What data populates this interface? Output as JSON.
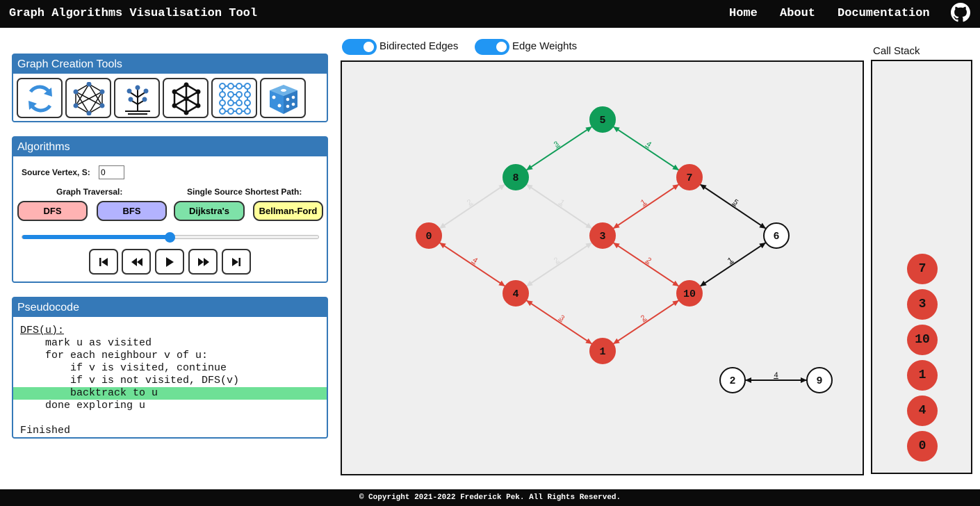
{
  "header": {
    "title": "Graph Algorithms Visualisation Tool",
    "nav": [
      "Home",
      "About",
      "Documentation"
    ],
    "github_icon": "github-icon"
  },
  "toggles": [
    {
      "label": "Bidirected Edges",
      "on": true
    },
    {
      "label": "Edge Weights",
      "on": true
    }
  ],
  "creation_tools": {
    "title": "Graph Creation Tools",
    "tools": [
      {
        "name": "reset-graph",
        "icon": "refresh-icon"
      },
      {
        "name": "complete-graph",
        "icon": "complete-graph-icon"
      },
      {
        "name": "tree-graph",
        "icon": "tree-icon"
      },
      {
        "name": "wheel-graph",
        "icon": "wheel-graph-icon"
      },
      {
        "name": "grid-graph",
        "icon": "grid-graph-icon"
      },
      {
        "name": "random-graph",
        "icon": "dice-icon"
      }
    ]
  },
  "algorithms": {
    "title": "Algorithms",
    "source_label": "Source Vertex, S:",
    "source_value": "0",
    "traversal_label": "Graph Traversal:",
    "sssp_label": "Single Source Shortest Path:",
    "buttons": [
      {
        "label": "DFS",
        "color": "#ffb3b3"
      },
      {
        "label": "BFS",
        "color": "#b3b3ff"
      },
      {
        "label": "Dijkstra's",
        "color": "#7ee2a8"
      },
      {
        "label": "Bellman-Ford",
        "color": "#ffff99"
      }
    ],
    "slider_value": 0.5,
    "controls": [
      "skip-to-start-icon",
      "rewind-icon",
      "play-icon",
      "fast-forward-icon",
      "skip-to-end-icon"
    ]
  },
  "pseudocode": {
    "title": "Pseudocode",
    "lines": [
      "DFS(u):",
      "    mark u as visited",
      "    for each neighbour v of u:",
      "        if v is visited, continue",
      "        if v is not visited, DFS(v)",
      "        backtrack to u",
      "    done exploring u",
      "",
      "Finished"
    ],
    "highlighted": 5
  },
  "graph": {
    "colors": {
      "visited": "#dc4337",
      "done": "#109d58",
      "unvisited": "#ffffff",
      "inactive_edge": "#d9d9d9",
      "plain_edge": "#111111"
    },
    "nodes": [
      {
        "id": "0",
        "state": "visited"
      },
      {
        "id": "1",
        "state": "visited"
      },
      {
        "id": "2",
        "state": "unvisited"
      },
      {
        "id": "3",
        "state": "visited"
      },
      {
        "id": "4",
        "state": "visited"
      },
      {
        "id": "5",
        "state": "done"
      },
      {
        "id": "6",
        "state": "unvisited"
      },
      {
        "id": "7",
        "state": "visited"
      },
      {
        "id": "8",
        "state": "done"
      },
      {
        "id": "9",
        "state": "unvisited"
      },
      {
        "id": "10",
        "state": "visited"
      }
    ],
    "edges": [
      {
        "from": "5",
        "to": "8",
        "weight": "3",
        "state": "done"
      },
      {
        "from": "5",
        "to": "7",
        "weight": "4",
        "state": "done"
      },
      {
        "from": "8",
        "to": "0",
        "weight": "2",
        "state": "inactive"
      },
      {
        "from": "8",
        "to": "3",
        "weight": "1",
        "state": "inactive"
      },
      {
        "from": "7",
        "to": "3",
        "weight": "1",
        "state": "visited"
      },
      {
        "from": "7",
        "to": "6",
        "weight": "5",
        "state": "plain"
      },
      {
        "from": "0",
        "to": "4",
        "weight": "4",
        "state": "visited"
      },
      {
        "from": "3",
        "to": "4",
        "weight": "2",
        "state": "inactive"
      },
      {
        "from": "3",
        "to": "10",
        "weight": "2",
        "state": "visited"
      },
      {
        "from": "6",
        "to": "10",
        "weight": "1",
        "state": "plain"
      },
      {
        "from": "4",
        "to": "1",
        "weight": "3",
        "state": "visited"
      },
      {
        "from": "10",
        "to": "1",
        "weight": "2",
        "state": "visited"
      },
      {
        "from": "2",
        "to": "9",
        "weight": "4",
        "state": "plain"
      }
    ]
  },
  "call_stack": {
    "title": "Call Stack",
    "items": [
      "7",
      "3",
      "10",
      "1",
      "4",
      "0"
    ]
  },
  "footer": {
    "text": "© Copyright 2021-2022 Frederick Pek. All Rights Reserved."
  }
}
